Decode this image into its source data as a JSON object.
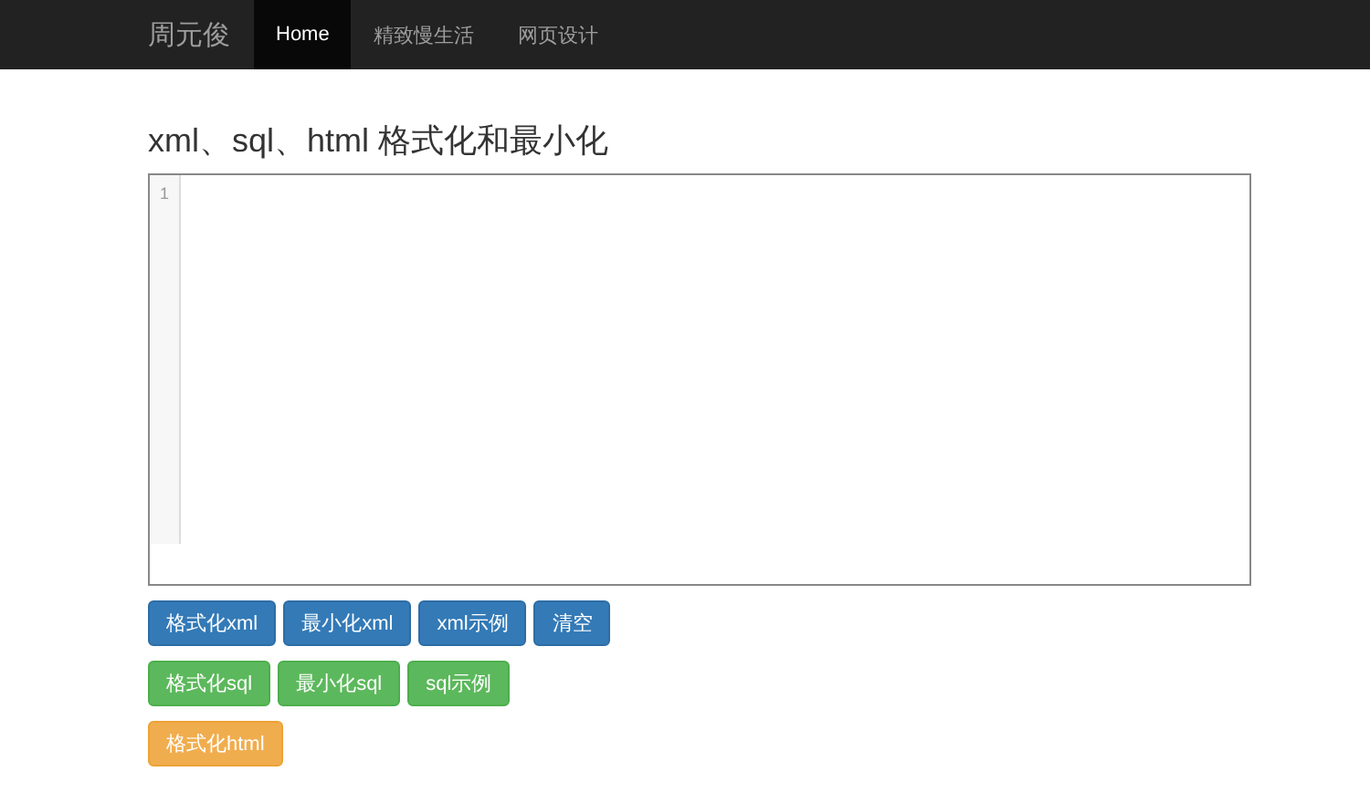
{
  "navbar": {
    "brand": "周元俊",
    "links": [
      {
        "label": "Home",
        "selected": true
      },
      {
        "label": "精致慢生活",
        "selected": false
      },
      {
        "label": "网页设计",
        "selected": false
      }
    ]
  },
  "heading": "xml、sql、html 格式化和最小化",
  "editor": {
    "line_numbers": [
      "1"
    ]
  },
  "button_rows": [
    {
      "kind": "primary",
      "buttons": [
        "格式化xml",
        "最小化xml",
        "xml示例",
        "清空"
      ]
    },
    {
      "kind": "success",
      "buttons": [
        "格式化sql",
        "最小化sql",
        "sql示例"
      ]
    },
    {
      "kind": "warning",
      "buttons": [
        "格式化html"
      ]
    }
  ]
}
